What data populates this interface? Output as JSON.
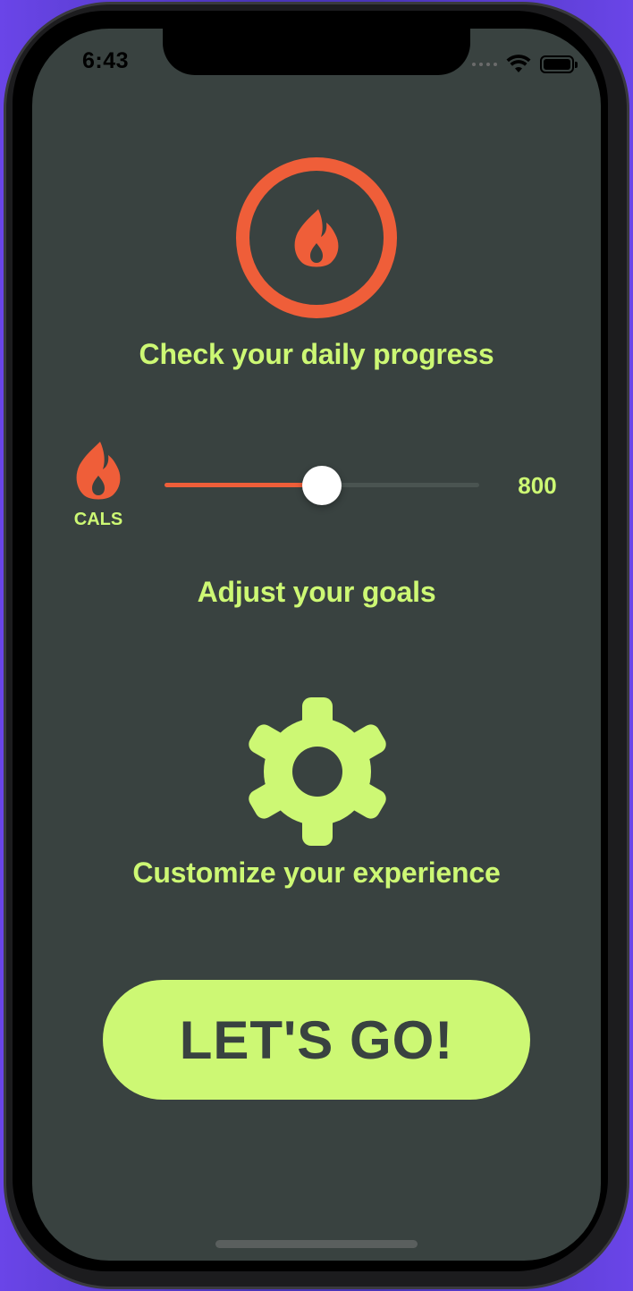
{
  "status_bar": {
    "time": "6:43"
  },
  "intro": {
    "step1_caption": "Check your daily progress",
    "step2_caption": "Adjust your goals",
    "step3_caption": "Customize your experience"
  },
  "goal_slider": {
    "unit_label": "CALS",
    "value": "800",
    "fill_fraction": 0.5
  },
  "cta": {
    "label": "LET'S GO!"
  },
  "icons": {
    "progress": "flame-icon",
    "slider": "flame-icon",
    "settings": "gear-icon"
  },
  "colors": {
    "background": "#394240",
    "accent": "#ef5e39",
    "highlight": "#cdf874",
    "button_text": "#394240"
  }
}
